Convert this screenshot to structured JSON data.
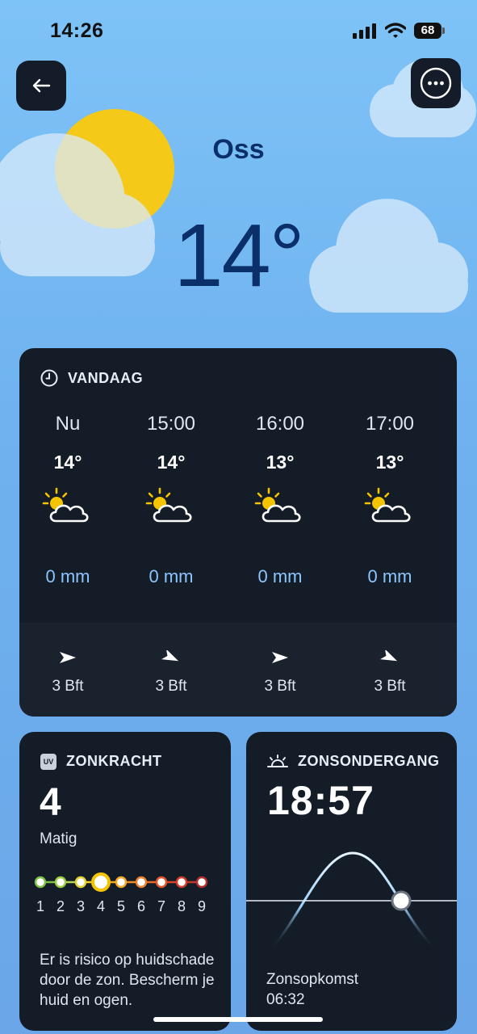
{
  "status": {
    "time": "14:26",
    "battery": "68"
  },
  "header": {
    "city": "Oss",
    "temperature": "14°"
  },
  "today": {
    "title": "VANDAAG",
    "hours": [
      {
        "label": "Nu",
        "temp": "14°",
        "icon": "partly-cloudy-icon",
        "rain": "0 mm",
        "wind": "3 Bft",
        "wind_icon": "wind-arrow-east-icon"
      },
      {
        "label": "15:00",
        "temp": "14°",
        "icon": "partly-cloudy-icon",
        "rain": "0 mm",
        "wind": "3 Bft",
        "wind_icon": "wind-arrow-southeast-icon"
      },
      {
        "label": "16:00",
        "temp": "13°",
        "icon": "partly-cloudy-icon",
        "rain": "0 mm",
        "wind": "3 Bft",
        "wind_icon": "wind-arrow-east-icon"
      },
      {
        "label": "17:00",
        "temp": "13°",
        "icon": "partly-cloudy-icon",
        "rain": "0 mm",
        "wind": "3 Bft",
        "wind_icon": "wind-arrow-southeast-icon"
      }
    ]
  },
  "uv": {
    "title": "ZONKRACHT",
    "badge": "UV",
    "value": "4",
    "level": "Matig",
    "scale": [
      "1",
      "2",
      "3",
      "4",
      "5",
      "6",
      "7",
      "8",
      "9"
    ],
    "current": 4,
    "text": "Er is risico op huidschade door de zon. Bescherm je huid en ogen."
  },
  "sun": {
    "title": "ZONSONDERGANG",
    "sunset": "18:57",
    "sunrise_label": "Zonsopkomst",
    "sunrise": "06:32"
  },
  "colors": {
    "card": "#141c27",
    "rain": "#8cc6ff",
    "sun": "#f5c400",
    "city": "#0b2f68"
  }
}
